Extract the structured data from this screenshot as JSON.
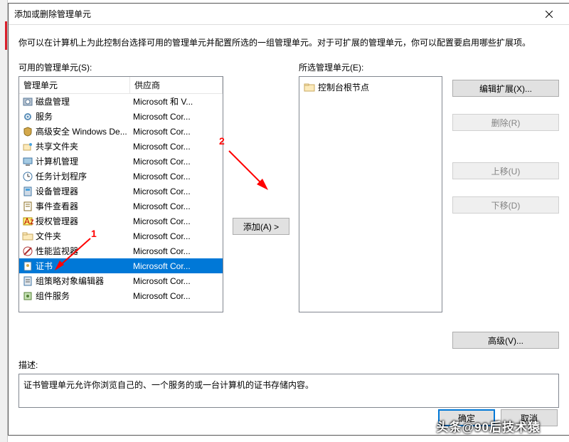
{
  "titlebar": {
    "title": "添加或删除管理单元"
  },
  "top_desc": "你可以在计算机上为此控制台选择可用的管理单元并配置所选的一组管理单元。对于可扩展的管理单元，你可以配置要启用哪些扩展项。",
  "labels": {
    "available": "可用的管理单元(S):",
    "selected": "所选管理单元(E):",
    "description": "描述:"
  },
  "headers": {
    "name": "管理单元",
    "vendor": "供应商"
  },
  "snapins": [
    {
      "label": "磁盘管理",
      "vendor": "Microsoft 和 V...",
      "icon": "disk"
    },
    {
      "label": "服务",
      "vendor": "Microsoft Cor...",
      "icon": "gear"
    },
    {
      "label": "高级安全 Windows De...",
      "vendor": "Microsoft Cor...",
      "icon": "shield"
    },
    {
      "label": "共享文件夹",
      "vendor": "Microsoft Cor...",
      "icon": "share"
    },
    {
      "label": "计算机管理",
      "vendor": "Microsoft Cor...",
      "icon": "computer"
    },
    {
      "label": "任务计划程序",
      "vendor": "Microsoft Cor...",
      "icon": "clock"
    },
    {
      "label": "设备管理器",
      "vendor": "Microsoft Cor...",
      "icon": "device"
    },
    {
      "label": "事件查看器",
      "vendor": "Microsoft Cor...",
      "icon": "event"
    },
    {
      "label": "授权管理器",
      "vendor": "Microsoft Cor...",
      "icon": "auth"
    },
    {
      "label": "文件夹",
      "vendor": "Microsoft Cor...",
      "icon": "folder"
    },
    {
      "label": "性能监视器",
      "vendor": "Microsoft Cor...",
      "icon": "perf"
    },
    {
      "label": "证书",
      "vendor": "Microsoft Cor...",
      "icon": "cert",
      "selected": true
    },
    {
      "label": "组策略对象编辑器",
      "vendor": "Microsoft Cor...",
      "icon": "gpo"
    },
    {
      "label": "组件服务",
      "vendor": "Microsoft Cor...",
      "icon": "comp"
    }
  ],
  "selected_root": "控制台根节点",
  "buttons": {
    "add": "添加(A)  >",
    "edit_ext": "编辑扩展(X)...",
    "remove": "删除(R)",
    "move_up": "上移(U)",
    "move_down": "下移(D)",
    "advanced": "高级(V)...",
    "ok": "确定",
    "cancel": "取消"
  },
  "description_text": "证书管理单元允许你浏览自己的、一个服务的或一台计算机的证书存储内容。",
  "annotations": {
    "a1": "1",
    "a2": "2"
  },
  "watermark": "头条@90后技术猿"
}
